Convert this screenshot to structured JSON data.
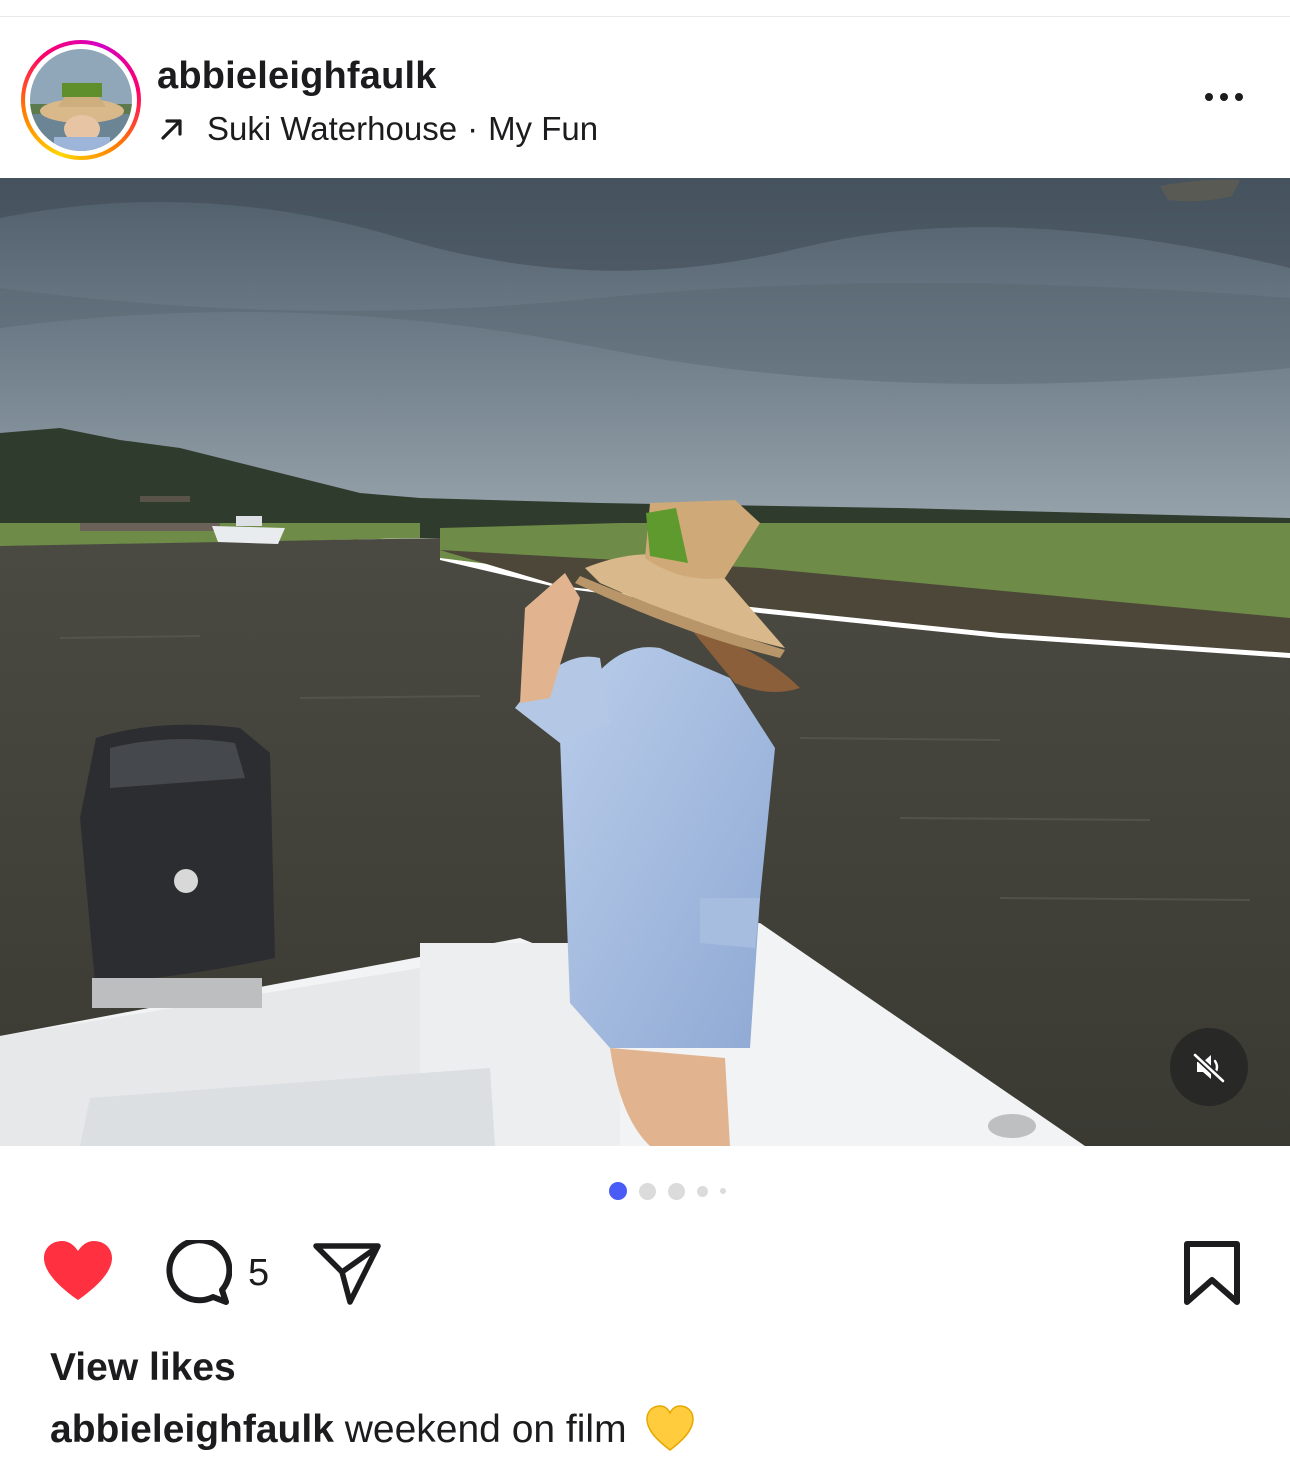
{
  "post": {
    "username": "abbieleighfaulk",
    "music": {
      "artist": "Suki Waterhouse",
      "separator": "·",
      "song": "My Fun"
    },
    "more_icon": "more-horizontal-icon"
  },
  "media": {
    "description_icon": "photo",
    "mute_icon": "speaker-muted-icon",
    "carousel": {
      "count": 5,
      "active_index": 1
    }
  },
  "actions": {
    "liked": true,
    "like_color": "#ff3040",
    "comment_count": "5",
    "icons": [
      "heart-filled-icon",
      "comment-icon",
      "share-send-icon",
      "bookmark-icon"
    ]
  },
  "footer": {
    "view_likes": "View likes",
    "caption_user": "abbieleighfaulk",
    "caption_text": "weekend on film",
    "caption_emoji": "💛"
  },
  "colors": {
    "accent_dot": "#4a5cf6",
    "text": "#1c1c1e"
  }
}
